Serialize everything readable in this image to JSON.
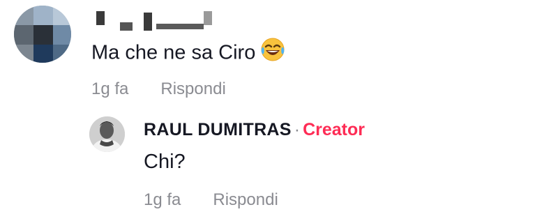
{
  "comment": {
    "text": "Ma che ne sa Ciro",
    "emoji": "face-with-tears-of-joy-icon",
    "time": "1g fa",
    "reply_label": "Rispondi"
  },
  "reply": {
    "author": "RAUL DUMITRAS",
    "separator": "·",
    "badge": "Creator",
    "text": "Chi?",
    "time": "1g fa",
    "reply_label": "Rispondi"
  },
  "colors": {
    "creator_badge": "#fe2c55",
    "meta_text": "#8a8b91",
    "body_text": "#161823"
  }
}
